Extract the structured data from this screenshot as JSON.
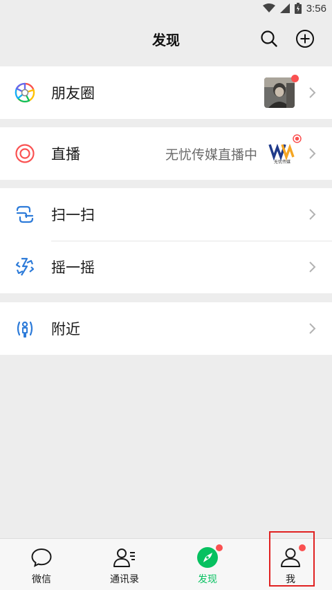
{
  "status_bar": {
    "time": "3:56"
  },
  "header": {
    "title": "发现"
  },
  "items": {
    "moments": {
      "label": "朋友圈"
    },
    "live": {
      "label": "直播",
      "status_text": "无忧传媒直播中"
    },
    "scan": {
      "label": "扫一扫"
    },
    "shake": {
      "label": "摇一摇"
    },
    "nearby": {
      "label": "附近"
    }
  },
  "live_logo_text": "无忧传媒",
  "tabs": [
    {
      "label": "微信",
      "icon": "chat-bubble-icon",
      "active": false
    },
    {
      "label": "通讯录",
      "icon": "contacts-icon",
      "active": false
    },
    {
      "label": "发现",
      "icon": "compass-icon",
      "active": true
    },
    {
      "label": "我",
      "icon": "person-icon",
      "active": false
    }
  ],
  "colors": {
    "accent_green": "#07c160",
    "badge_red": "#fa5151",
    "scan_blue": "#2d7bd9",
    "live_red": "#fa5151",
    "highlight_red": "#e02020"
  }
}
